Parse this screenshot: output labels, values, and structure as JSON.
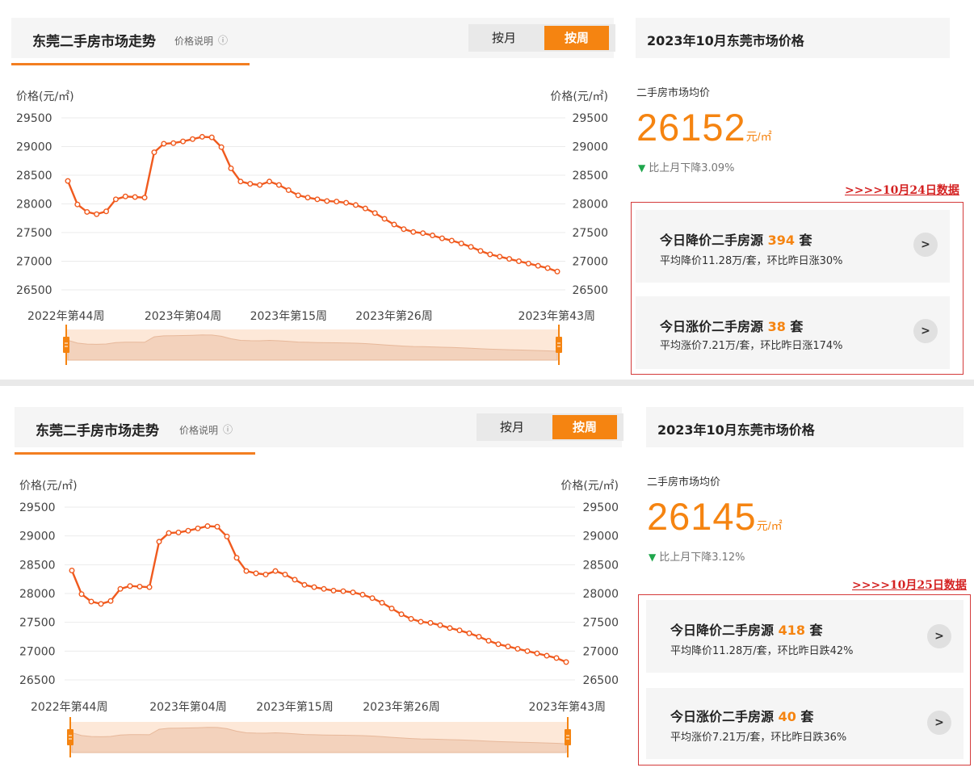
{
  "colors": {
    "accent": "#f58411",
    "line": "#f05a1e",
    "down": "#1fa64c",
    "note": "#d42222"
  },
  "panels": [
    {
      "left": {
        "title": "东莞二手房市场走势",
        "subtitle": "价格说明",
        "help_icon": "question-circle-icon",
        "toggle": [
          "按月",
          "按周"
        ],
        "active_toggle": "按周"
      },
      "right": {
        "title": "2023年10月东莞市场价格",
        "avg_label": "二手房市场均价",
        "avg_price": "26152",
        "avg_unit": "元/㎡",
        "change_text": "比上月下降3.09%",
        "date_note": ">>>>10月24日数据",
        "cards": [
          {
            "prefix": "今日降价二手房源 ",
            "count": "394",
            "suffix": " 套",
            "detail": "平均降价11.28万/套，环比昨日涨30%"
          },
          {
            "prefix": "今日涨价二手房源 ",
            "count": "38",
            "suffix": " 套",
            "detail": "平均涨价7.21万/套，环比昨日涨174%"
          }
        ]
      }
    },
    {
      "left": {
        "title": "东莞二手房市场走势",
        "subtitle": "价格说明",
        "help_icon": "question-circle-icon",
        "toggle": [
          "按月",
          "按周"
        ],
        "active_toggle": "按周"
      },
      "right": {
        "title": "2023年10月东莞市场价格",
        "avg_label": "二手房市场均价",
        "avg_price": "26145",
        "avg_unit": "元/㎡",
        "change_text": "比上月下降3.12%",
        "date_note": ">>>>10月25日数据",
        "cards": [
          {
            "prefix": "今日降价二手房源 ",
            "count": "418",
            "suffix": " 套",
            "detail": "平均降价11.28万/套，环比昨日跌42%"
          },
          {
            "prefix": "今日涨价二手房源 ",
            "count": "40",
            "suffix": " 套",
            "detail": "平均涨价7.21万/套，环比昨日跌36%"
          }
        ]
      }
    }
  ],
  "chart_data": [
    {
      "type": "line",
      "ylabel_left": "价格(元/㎡)",
      "ylabel_right": "价格(元/㎡)",
      "ylim": [
        26500,
        29500
      ],
      "yticks": [
        26500,
        27000,
        27500,
        28000,
        28500,
        29000,
        29500
      ],
      "xtick_labels": [
        "2022年第44周",
        "2023年第04周",
        "2023年第15周",
        "2023年第26周",
        "2023年第43周"
      ],
      "xtick_index": [
        0,
        12,
        23,
        34,
        51
      ],
      "grid": true,
      "series": [
        {
          "values": [
            28400,
            27990,
            27860,
            27820,
            27870,
            28080,
            28130,
            28120,
            28110,
            28900,
            29050,
            29060,
            29090,
            29130,
            29170,
            29160,
            28990,
            28620,
            28390,
            28350,
            28330,
            28390,
            28330,
            28240,
            28150,
            28110,
            28080,
            28050,
            28040,
            28020,
            27980,
            27920,
            27840,
            27740,
            27640,
            27560,
            27510,
            27490,
            27450,
            27400,
            27360,
            27310,
            27250,
            27180,
            27120,
            27080,
            27040,
            27000,
            26960,
            26920,
            26880,
            26820
          ]
        }
      ]
    },
    {
      "type": "line",
      "ylabel_left": "价格(元/㎡)",
      "ylabel_right": "价格(元/㎡)",
      "ylim": [
        26500,
        29500
      ],
      "yticks": [
        26500,
        27000,
        27500,
        28000,
        28500,
        29000,
        29500
      ],
      "xtick_labels": [
        "2022年第44周",
        "2023年第04周",
        "2023年第15周",
        "2023年第26周",
        "2023年第43周"
      ],
      "xtick_index": [
        0,
        12,
        23,
        34,
        51
      ],
      "grid": true,
      "series": [
        {
          "values": [
            28400,
            27990,
            27860,
            27820,
            27870,
            28080,
            28130,
            28120,
            28110,
            28900,
            29050,
            29060,
            29090,
            29130,
            29170,
            29160,
            28990,
            28620,
            28390,
            28350,
            28330,
            28390,
            28330,
            28240,
            28150,
            28110,
            28080,
            28050,
            28040,
            28020,
            27980,
            27920,
            27840,
            27740,
            27640,
            27560,
            27510,
            27490,
            27450,
            27400,
            27360,
            27310,
            27250,
            27180,
            27120,
            27080,
            27040,
            27000,
            26960,
            26920,
            26880,
            26810
          ]
        }
      ]
    }
  ]
}
